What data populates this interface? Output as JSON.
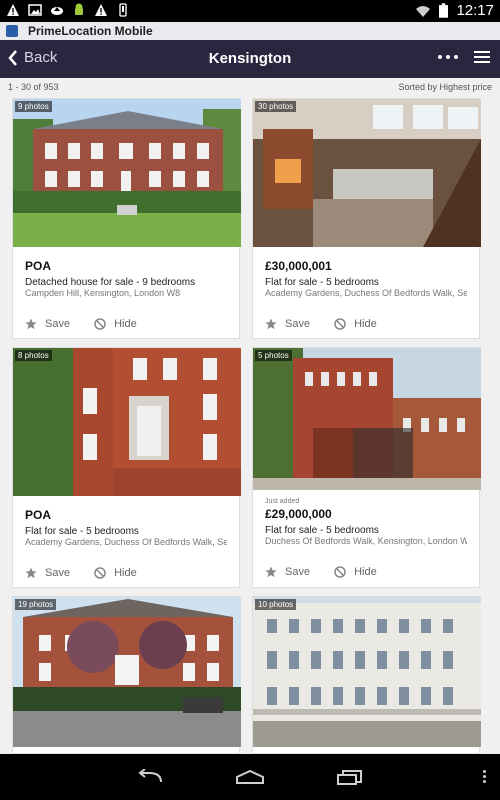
{
  "status_bar": {
    "time": "12:17"
  },
  "app": {
    "title": "PrimeLocation Mobile"
  },
  "nav": {
    "back_label": "Back",
    "title": "Kensington"
  },
  "results": {
    "count_text": "1 - 30 of 953",
    "sort_text": "Sorted by Highest price"
  },
  "listings": [
    {
      "photos": "9 photos",
      "just_added": "",
      "price": "POA",
      "type": "Detached house for sale - 9 bedrooms",
      "address": "Campden Hill, Kensington, London W8",
      "save_label": "Save",
      "hide_label": "Hide"
    },
    {
      "photos": "30 photos",
      "just_added": "",
      "price": "£30,000,001",
      "type": "Flat for sale - 5 bedrooms",
      "address": "Academy Gardens, Duchess Of Bedfords Walk, Se",
      "save_label": "Save",
      "hide_label": "Hide"
    },
    {
      "photos": "8 photos",
      "just_added": "",
      "price": "POA",
      "type": "Flat for sale - 5 bedrooms",
      "address": "Academy Gardens, Duchess Of Bedfords Walk, Se",
      "save_label": "Save",
      "hide_label": "Hide"
    },
    {
      "photos": "5 photos",
      "just_added": "Just added",
      "price": "£29,000,000",
      "type": "Flat for sale - 5 bedrooms",
      "address": "Duchess Of Bedfords Walk, Kensington, London W",
      "save_label": "Save",
      "hide_label": "Hide"
    },
    {
      "photos": "19 photos"
    },
    {
      "photos": "10 photos"
    }
  ],
  "colors": {
    "nav_bg": "#2b2540",
    "status_bg": "#000000",
    "page_bg": "#f0f0f0"
  },
  "icons": [
    "warning-icon",
    "image-icon",
    "cloud-upload-icon",
    "android-icon",
    "usb-icon",
    "wifi-icon",
    "battery-icon",
    "chevron-left-icon",
    "more-dots-icon",
    "hamburger-menu-icon",
    "star-icon",
    "hide-icon",
    "back-nav-icon",
    "home-nav-icon",
    "recent-apps-icon",
    "overflow-menu-icon"
  ]
}
